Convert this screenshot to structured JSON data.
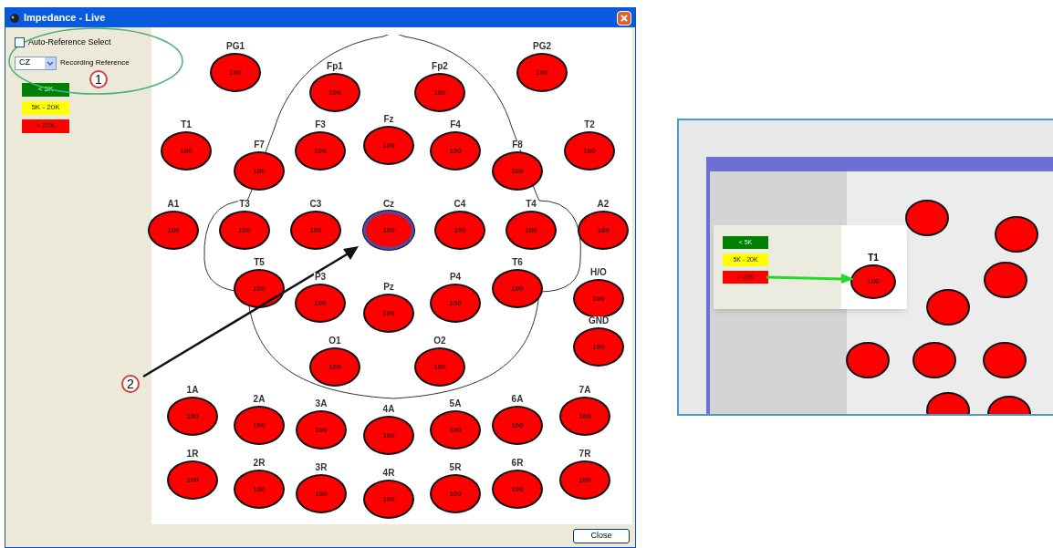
{
  "window": {
    "title": "Impedance - Live"
  },
  "auto_reference": {
    "label": "Auto-Reference Select",
    "checked": false
  },
  "recording_reference": {
    "value": "CZ",
    "label": "Recording Reference"
  },
  "legend": [
    {
      "label": "< 5K",
      "color": "#008000"
    },
    {
      "label": "5K - 20K",
      "color": "#ffff00"
    },
    {
      "label": "> 20K",
      "color": "#ff0000"
    }
  ],
  "electrodes": [
    {
      "label": "PG1",
      "value": "100",
      "selected": false
    },
    {
      "label": "Fp1",
      "value": "100",
      "selected": false
    },
    {
      "label": "Fp2",
      "value": "100",
      "selected": false
    },
    {
      "label": "PG2",
      "value": "100",
      "selected": false
    },
    {
      "label": "T1",
      "value": "100",
      "selected": false
    },
    {
      "label": "F7",
      "value": "100",
      "selected": false
    },
    {
      "label": "F3",
      "value": "100",
      "selected": false
    },
    {
      "label": "Fz",
      "value": "100",
      "selected": false
    },
    {
      "label": "F4",
      "value": "100",
      "selected": false
    },
    {
      "label": "F8",
      "value": "100",
      "selected": false
    },
    {
      "label": "T2",
      "value": "100",
      "selected": false
    },
    {
      "label": "A1",
      "value": "100",
      "selected": false
    },
    {
      "label": "T3",
      "value": "100",
      "selected": false
    },
    {
      "label": "C3",
      "value": "100",
      "selected": false
    },
    {
      "label": "Cz",
      "value": "100",
      "selected": true
    },
    {
      "label": "C4",
      "value": "100",
      "selected": false
    },
    {
      "label": "T4",
      "value": "100",
      "selected": false
    },
    {
      "label": "A2",
      "value": "100",
      "selected": false
    },
    {
      "label": "T5",
      "value": "100",
      "selected": false
    },
    {
      "label": "P3",
      "value": "100",
      "selected": false
    },
    {
      "label": "Pz",
      "value": "100",
      "selected": false
    },
    {
      "label": "P4",
      "value": "100",
      "selected": false
    },
    {
      "label": "T6",
      "value": "100",
      "selected": false
    },
    {
      "label": "H/O",
      "value": "100",
      "selected": false
    },
    {
      "label": "GND",
      "value": "100",
      "selected": false
    },
    {
      "label": "O1",
      "value": "100",
      "selected": false
    },
    {
      "label": "O2",
      "value": "100",
      "selected": false
    },
    {
      "label": "1A",
      "value": "100",
      "selected": false
    },
    {
      "label": "2A",
      "value": "100",
      "selected": false
    },
    {
      "label": "3A",
      "value": "100",
      "selected": false
    },
    {
      "label": "4A",
      "value": "100",
      "selected": false
    },
    {
      "label": "5A",
      "value": "100",
      "selected": false
    },
    {
      "label": "6A",
      "value": "100",
      "selected": false
    },
    {
      "label": "7A",
      "value": "100",
      "selected": false
    },
    {
      "label": "1R",
      "value": "100",
      "selected": false
    },
    {
      "label": "2R",
      "value": "100",
      "selected": false
    },
    {
      "label": "3R",
      "value": "100",
      "selected": false
    },
    {
      "label": "4R",
      "value": "100",
      "selected": false
    },
    {
      "label": "5R",
      "value": "100",
      "selected": false
    },
    {
      "label": "6R",
      "value": "100",
      "selected": false
    },
    {
      "label": "7R",
      "value": "100",
      "selected": false
    }
  ],
  "close_button": {
    "label": "Close"
  },
  "annotations": [
    {
      "number": "1"
    },
    {
      "number": "2"
    }
  ],
  "inset": {
    "legend": [
      {
        "label": "< 5K",
        "color": "#008000"
      },
      {
        "label": "5K - 20K",
        "color": "#ffff00"
      },
      {
        "label": "> 20K",
        "color": "#ff0000"
      }
    ],
    "electrode": {
      "label": "T1",
      "value": "100"
    }
  }
}
